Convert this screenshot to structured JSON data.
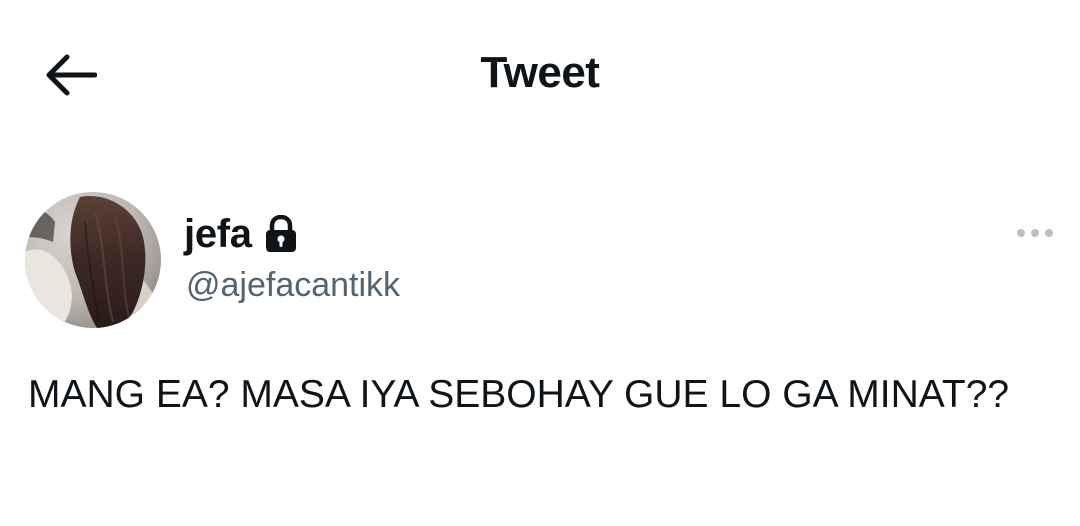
{
  "header": {
    "title": "Tweet",
    "back_icon": "arrow-left-icon"
  },
  "tweet": {
    "author": {
      "name": "jefa",
      "handle": "@ajefacantikk",
      "protected_icon": "lock-icon",
      "avatar": "profile-photo"
    },
    "more_icon": "more-horizontal-icon",
    "text": "MANG EA? MASA IYA SEBOHAY GUE LO GA MINAT??"
  },
  "colors": {
    "primary_text": "#0f1419",
    "secondary_text": "#536471",
    "background": "#ffffff",
    "muted_icon": "#b9c0c6"
  }
}
